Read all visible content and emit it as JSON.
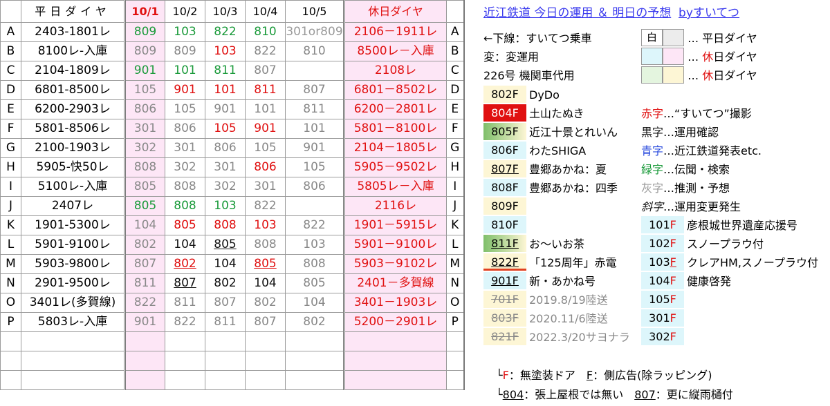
{
  "header": {
    "weekday": "平日ダイヤ",
    "dates": [
      "10/1",
      "10/2",
      "10/3",
      "10/4",
      "10/5"
    ],
    "holiday": "休日ダイヤ"
  },
  "rows": [
    {
      "id": "A",
      "route": "2403-1801レ",
      "d": [
        [
          "809",
          "g"
        ],
        [
          "103",
          "g"
        ],
        [
          "822",
          "g"
        ],
        [
          "810",
          "g"
        ],
        [
          "301or809",
          "gya"
        ]
      ],
      "hol": "2106－1911レ",
      "hid": "A"
    },
    {
      "id": "B",
      "route": "8100レ-入庫",
      "d": [
        [
          "809",
          "gy"
        ],
        [
          "809",
          "gy"
        ],
        [
          "103",
          "r"
        ],
        [
          "822",
          "gy"
        ],
        [
          "810",
          "gy"
        ]
      ],
      "hol": "8500レ－入庫",
      "hid": "B"
    },
    {
      "id": "C",
      "route": "2104-1809レ",
      "d": [
        [
          "901",
          "g"
        ],
        [
          "101",
          "g"
        ],
        [
          "811",
          "g"
        ],
        [
          "807",
          "gy"
        ],
        [
          "",
          ""
        ]
      ],
      "hol": "2108レ",
      "hid": "C"
    },
    {
      "id": "D",
      "route": "6801-8500レ",
      "d": [
        [
          "105",
          "gy"
        ],
        [
          "901",
          "r"
        ],
        [
          "101",
          "r"
        ],
        [
          "811",
          "r"
        ],
        [
          "807",
          "gy"
        ]
      ],
      "hol": "6801－8502レ",
      "hid": "D"
    },
    {
      "id": "E",
      "route": "6200-2903レ",
      "d": [
        [
          "806",
          "gy"
        ],
        [
          "105",
          "gy"
        ],
        [
          "901",
          "gy"
        ],
        [
          "101",
          "gy"
        ],
        [
          "811",
          "gy"
        ]
      ],
      "hol": "6200－2801レ",
      "hid": "E"
    },
    {
      "id": "F",
      "route": "5801-8506レ",
      "d": [
        [
          "301",
          "gy"
        ],
        [
          "806",
          "gy"
        ],
        [
          "105",
          "r"
        ],
        [
          "901",
          "r"
        ],
        [
          "101",
          "gy"
        ]
      ],
      "hol": "5801－8100レ",
      "hid": "F"
    },
    {
      "id": "G",
      "route": "2100-1903レ",
      "d": [
        [
          "302",
          "gy"
        ],
        [
          "301",
          "gy"
        ],
        [
          "806",
          "gy"
        ],
        [
          "105",
          "gy"
        ],
        [
          "901",
          "gy"
        ]
      ],
      "hol": "2104－1805レ",
      "hid": "G"
    },
    {
      "id": "H",
      "route": "5905-快50レ",
      "d": [
        [
          "808",
          "gy"
        ],
        [
          "302",
          "gy"
        ],
        [
          "301",
          "gy"
        ],
        [
          "806",
          "r"
        ],
        [
          "105",
          "gy"
        ]
      ],
      "hol": "5905－9502レ",
      "hid": "H"
    },
    {
      "id": "I",
      "route": "5100レ-入庫",
      "d": [
        [
          "805",
          "gy"
        ],
        [
          "808",
          "gy"
        ],
        [
          "302",
          "gy"
        ],
        [
          "301",
          "gy"
        ],
        [
          "806",
          "gy"
        ]
      ],
      "hol": "5805レ－入庫",
      "hid": "I"
    },
    {
      "id": "J",
      "route": "2407レ",
      "d": [
        [
          "805",
          "g"
        ],
        [
          "808",
          "g"
        ],
        [
          "103",
          "g"
        ],
        [
          "822",
          "gy"
        ],
        [
          "",
          ""
        ]
      ],
      "hol": "2116レ",
      "hid": "J"
    },
    {
      "id": "K",
      "route": "1901-5300レ",
      "d": [
        [
          "104",
          "gy"
        ],
        [
          "805",
          "r"
        ],
        [
          "808",
          "r"
        ],
        [
          "103",
          "r"
        ],
        [
          "822",
          "gy"
        ]
      ],
      "hol": "1901－5915レ",
      "hid": "K"
    },
    {
      "id": "L",
      "route": "5901-9100レ",
      "d": [
        [
          "802",
          "gy"
        ],
        [
          "104",
          "k"
        ],
        [
          "805",
          "ku"
        ],
        [
          "808",
          "gy"
        ],
        [
          "103",
          "gy"
        ]
      ],
      "hol": "5901－9100レ",
      "hid": "L"
    },
    {
      "id": "M",
      "route": "5903-9800レ",
      "d": [
        [
          "807",
          "gy"
        ],
        [
          "802",
          "ru"
        ],
        [
          "104",
          "k"
        ],
        [
          "805",
          "ru"
        ],
        [
          "808",
          "gy"
        ]
      ],
      "hol": "5903－9102レ",
      "hid": "M"
    },
    {
      "id": "N",
      "route": "2901-9500レ",
      "d": [
        [
          "811",
          "gy"
        ],
        [
          "807",
          "ku"
        ],
        [
          "802",
          "k"
        ],
        [
          "104",
          "k"
        ],
        [
          "805",
          "gy"
        ]
      ],
      "hol": "2401－多賀線",
      "hid": "N"
    },
    {
      "id": "O",
      "route": "3401レ(多賀線)",
      "d": [
        [
          "822",
          "gy"
        ],
        [
          "811",
          "gy"
        ],
        [
          "807",
          "gy"
        ],
        [
          "802",
          "gy"
        ],
        [
          "104",
          "gy"
        ]
      ],
      "hol": "3401－1903レ",
      "hid": "O"
    },
    {
      "id": "P",
      "route": "5803レ-入庫",
      "d": [
        [
          "901",
          "gy"
        ],
        [
          "822",
          "gy"
        ],
        [
          "811",
          "gy"
        ],
        [
          "807",
          "gy"
        ],
        [
          "802",
          "gy"
        ]
      ],
      "hol": "5200－2901レ",
      "hid": "P"
    }
  ],
  "legend": {
    "title": "近江鉄道 今日の運用 ＆ 明日の予想",
    "by": "byすいてつ",
    "l1": "←下線：すいてつ乗車",
    "l2": "変：変運用",
    "l3": "226号 機関車代用",
    "white": "白",
    "key1": "… 平日ダイヤ",
    "key2a": "… ",
    "key2b": "休",
    "key2c": "日ダイヤ",
    "key3a": "… ",
    "key3b": "休",
    "key3c": "日ダイヤ",
    "cars": [
      {
        "no": "802F",
        "name": "DyDo"
      },
      {
        "no": "804F",
        "name": "土山たぬき"
      },
      {
        "no": "805F",
        "name": "近江十景とれいん"
      },
      {
        "no": "806F",
        "name": "わたSHIGA"
      },
      {
        "no": "807F",
        "name": "豊郷あかね：夏"
      },
      {
        "no": "808F",
        "name": "豊郷あかね：四季"
      },
      {
        "no": "809F",
        "name": ""
      },
      {
        "no": "810F",
        "name": ""
      },
      {
        "no": "811F",
        "name": "お～いお茶"
      },
      {
        "no": "822F",
        "name": "「125周年」赤電"
      },
      {
        "no": "901F",
        "name": "新・あかね号"
      },
      {
        "no": "701F",
        "name": "2019.8/19陸送"
      },
      {
        "no": "803F",
        "name": "2020.11/6陸送"
      },
      {
        "no": "821F",
        "name": "2022.3/20サヨナラ"
      }
    ],
    "colors": [
      {
        "k": "赤字",
        "v": "…“すいてつ”撮影"
      },
      {
        "k": "黒字",
        "v": "…運用確認"
      },
      {
        "k": "青字",
        "v": "…近江鉄道発表etc."
      },
      {
        "k": "緑字",
        "v": "…伝聞・検索"
      },
      {
        "k": "灰字",
        "v": "…推測・予想"
      },
      {
        "k": "斜字",
        "v": "…運用変更発生"
      }
    ],
    "specials": [
      {
        "no": "101",
        "f": "F",
        "name": "彦根城世界遺産応援号"
      },
      {
        "no": "102",
        "f": "F",
        "name": "スノープラウ付"
      },
      {
        "no": "103",
        "f": "F",
        "name": "クレアHM,スノープラウ付"
      },
      {
        "no": "104",
        "f": "F",
        "name": "健康啓発"
      },
      {
        "no": "105",
        "f": "F",
        "name": ""
      },
      {
        "no": "301",
        "f": "F",
        "name": ""
      },
      {
        "no": "302",
        "f": "F",
        "name": ""
      }
    ],
    "foot1a": "└",
    "foot1b": "F",
    "foot1c": "：無塗装ドア　",
    "foot1d": "F",
    "foot1e": "：側広告(除ラッピング)",
    "foot2a": "└",
    "foot2b": "804",
    "foot2c": "：張上屋根では無い　",
    "foot2d": "807",
    "foot2e": "：更に縦雨樋付"
  }
}
